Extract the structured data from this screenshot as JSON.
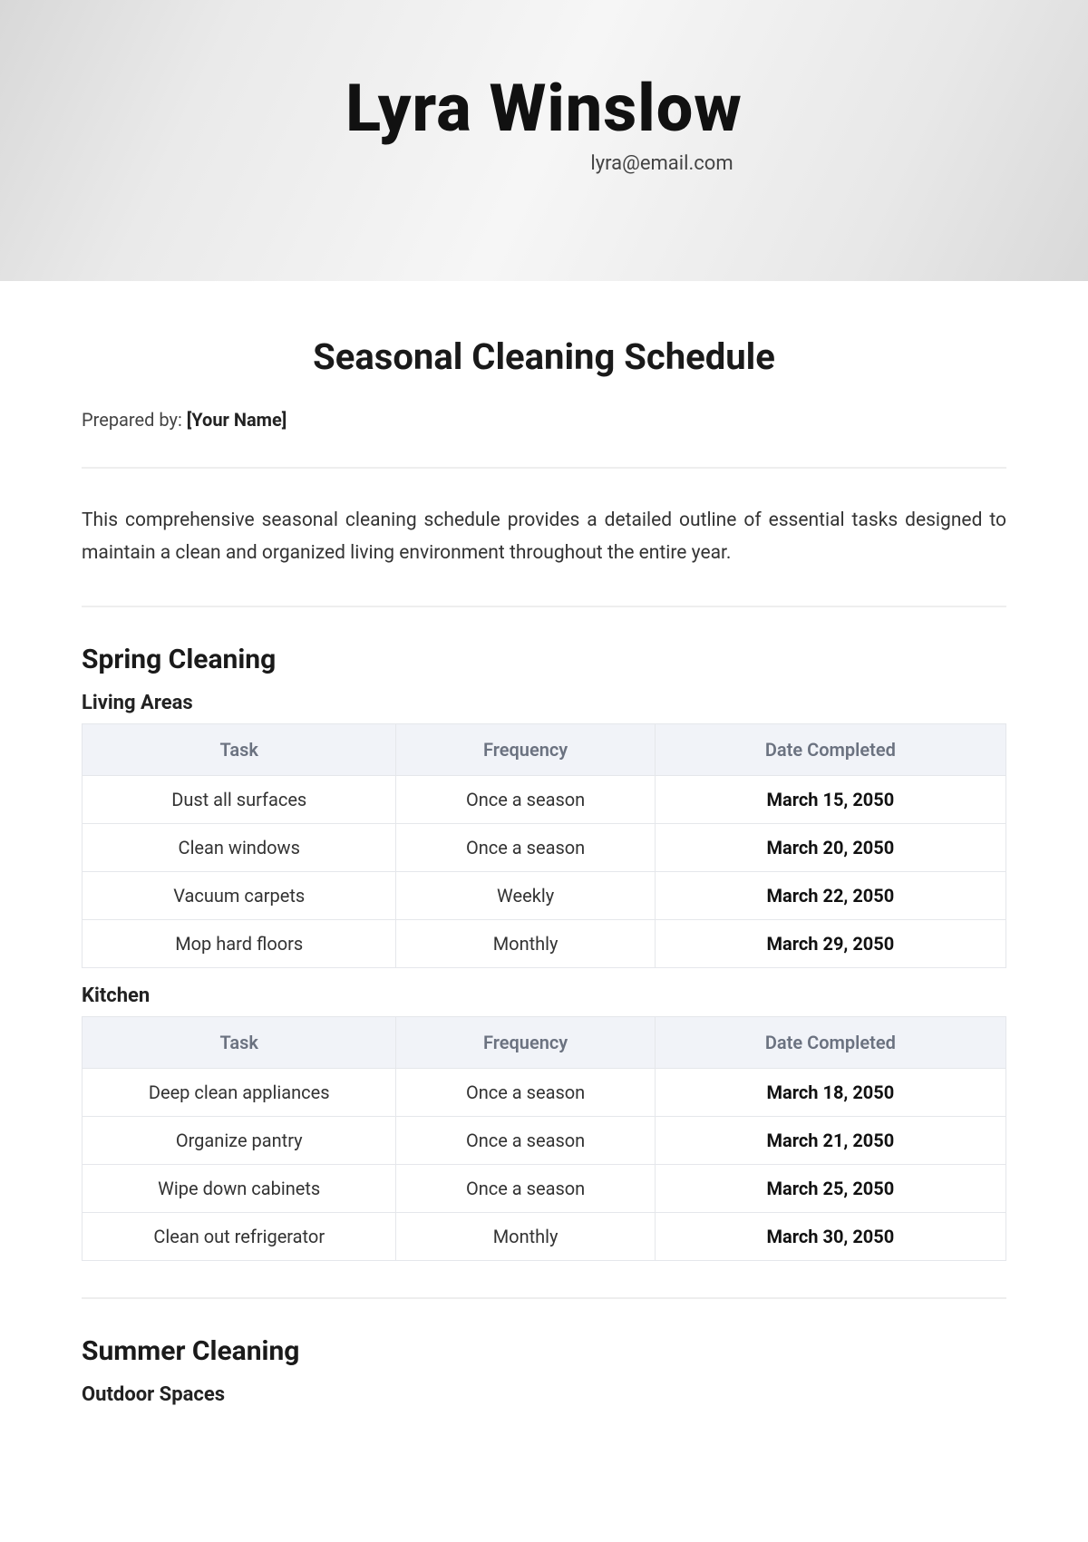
{
  "header": {
    "name": "Lyra Winslow",
    "email": "lyra@email.com"
  },
  "doc_title": "Seasonal Cleaning Schedule",
  "prepared_by_label": "Prepared by: ",
  "prepared_by_value": "[Your Name]",
  "intro": "This comprehensive seasonal cleaning schedule provides a detailed outline of essential tasks designed to maintain a clean and organized living environment throughout the entire year.",
  "table_headers": {
    "task": "Task",
    "frequency": "Frequency",
    "date_completed": "Date Completed"
  },
  "sections": [
    {
      "title": "Spring Cleaning",
      "subsections": [
        {
          "title": "Living Areas",
          "rows": [
            {
              "task": "Dust all surfaces",
              "frequency": "Once a season",
              "date": "March 15, 2050"
            },
            {
              "task": "Clean windows",
              "frequency": "Once a season",
              "date": "March 20, 2050"
            },
            {
              "task": "Vacuum carpets",
              "frequency": "Weekly",
              "date": "March 22, 2050"
            },
            {
              "task": "Mop hard floors",
              "frequency": "Monthly",
              "date": "March 29, 2050"
            }
          ]
        },
        {
          "title": "Kitchen",
          "rows": [
            {
              "task": "Deep clean appliances",
              "frequency": "Once a season",
              "date": "March 18, 2050"
            },
            {
              "task": "Organize pantry",
              "frequency": "Once a season",
              "date": "March 21, 2050"
            },
            {
              "task": "Wipe down cabinets",
              "frequency": "Once a season",
              "date": "March 25, 2050"
            },
            {
              "task": "Clean out refrigerator",
              "frequency": "Monthly",
              "date": "March 30, 2050"
            }
          ]
        }
      ]
    },
    {
      "title": "Summer Cleaning",
      "subsections": [
        {
          "title": "Outdoor Spaces",
          "rows": []
        }
      ]
    }
  ]
}
